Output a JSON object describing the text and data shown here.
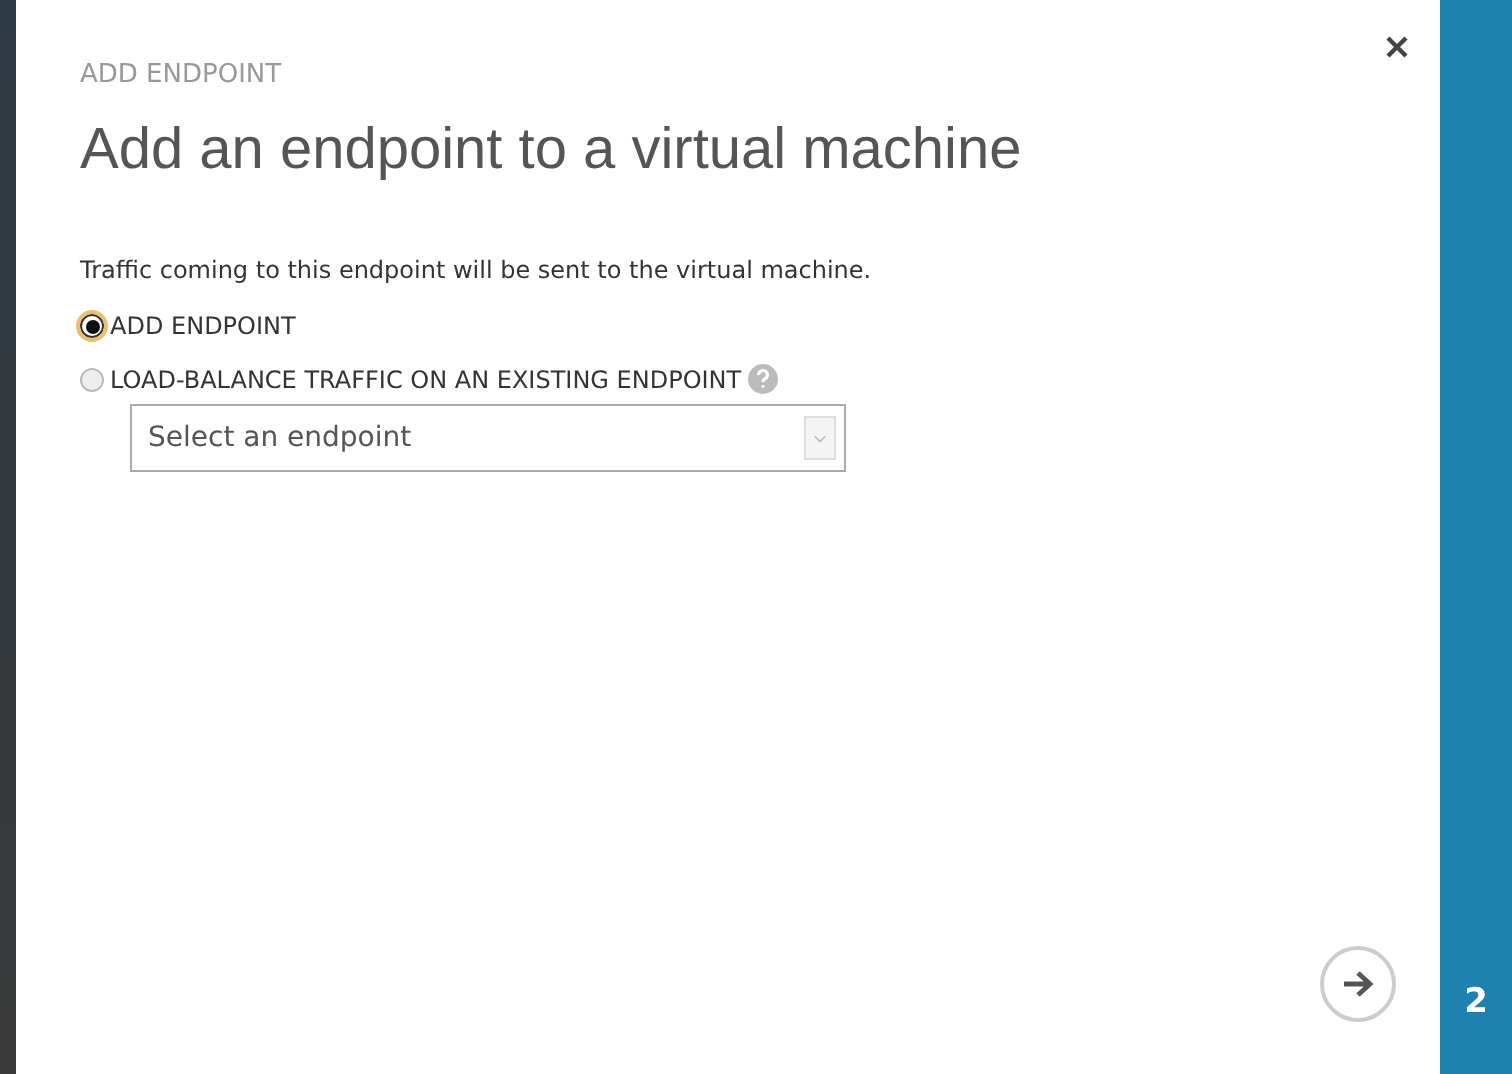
{
  "dialog": {
    "subtitle": "ADD ENDPOINT",
    "title": "Add an endpoint to a virtual machine",
    "description": "Traffic coming to this endpoint will be sent to the virtual machine.",
    "options": [
      {
        "label": "ADD ENDPOINT",
        "selected": true,
        "help": false
      },
      {
        "label": "LOAD-BALANCE TRAFFIC ON AN EXISTING ENDPOINT",
        "selected": false,
        "help": true
      }
    ],
    "endpoint_select": {
      "placeholder": "Select an endpoint",
      "disabled": true
    }
  },
  "step": {
    "number": "2"
  }
}
